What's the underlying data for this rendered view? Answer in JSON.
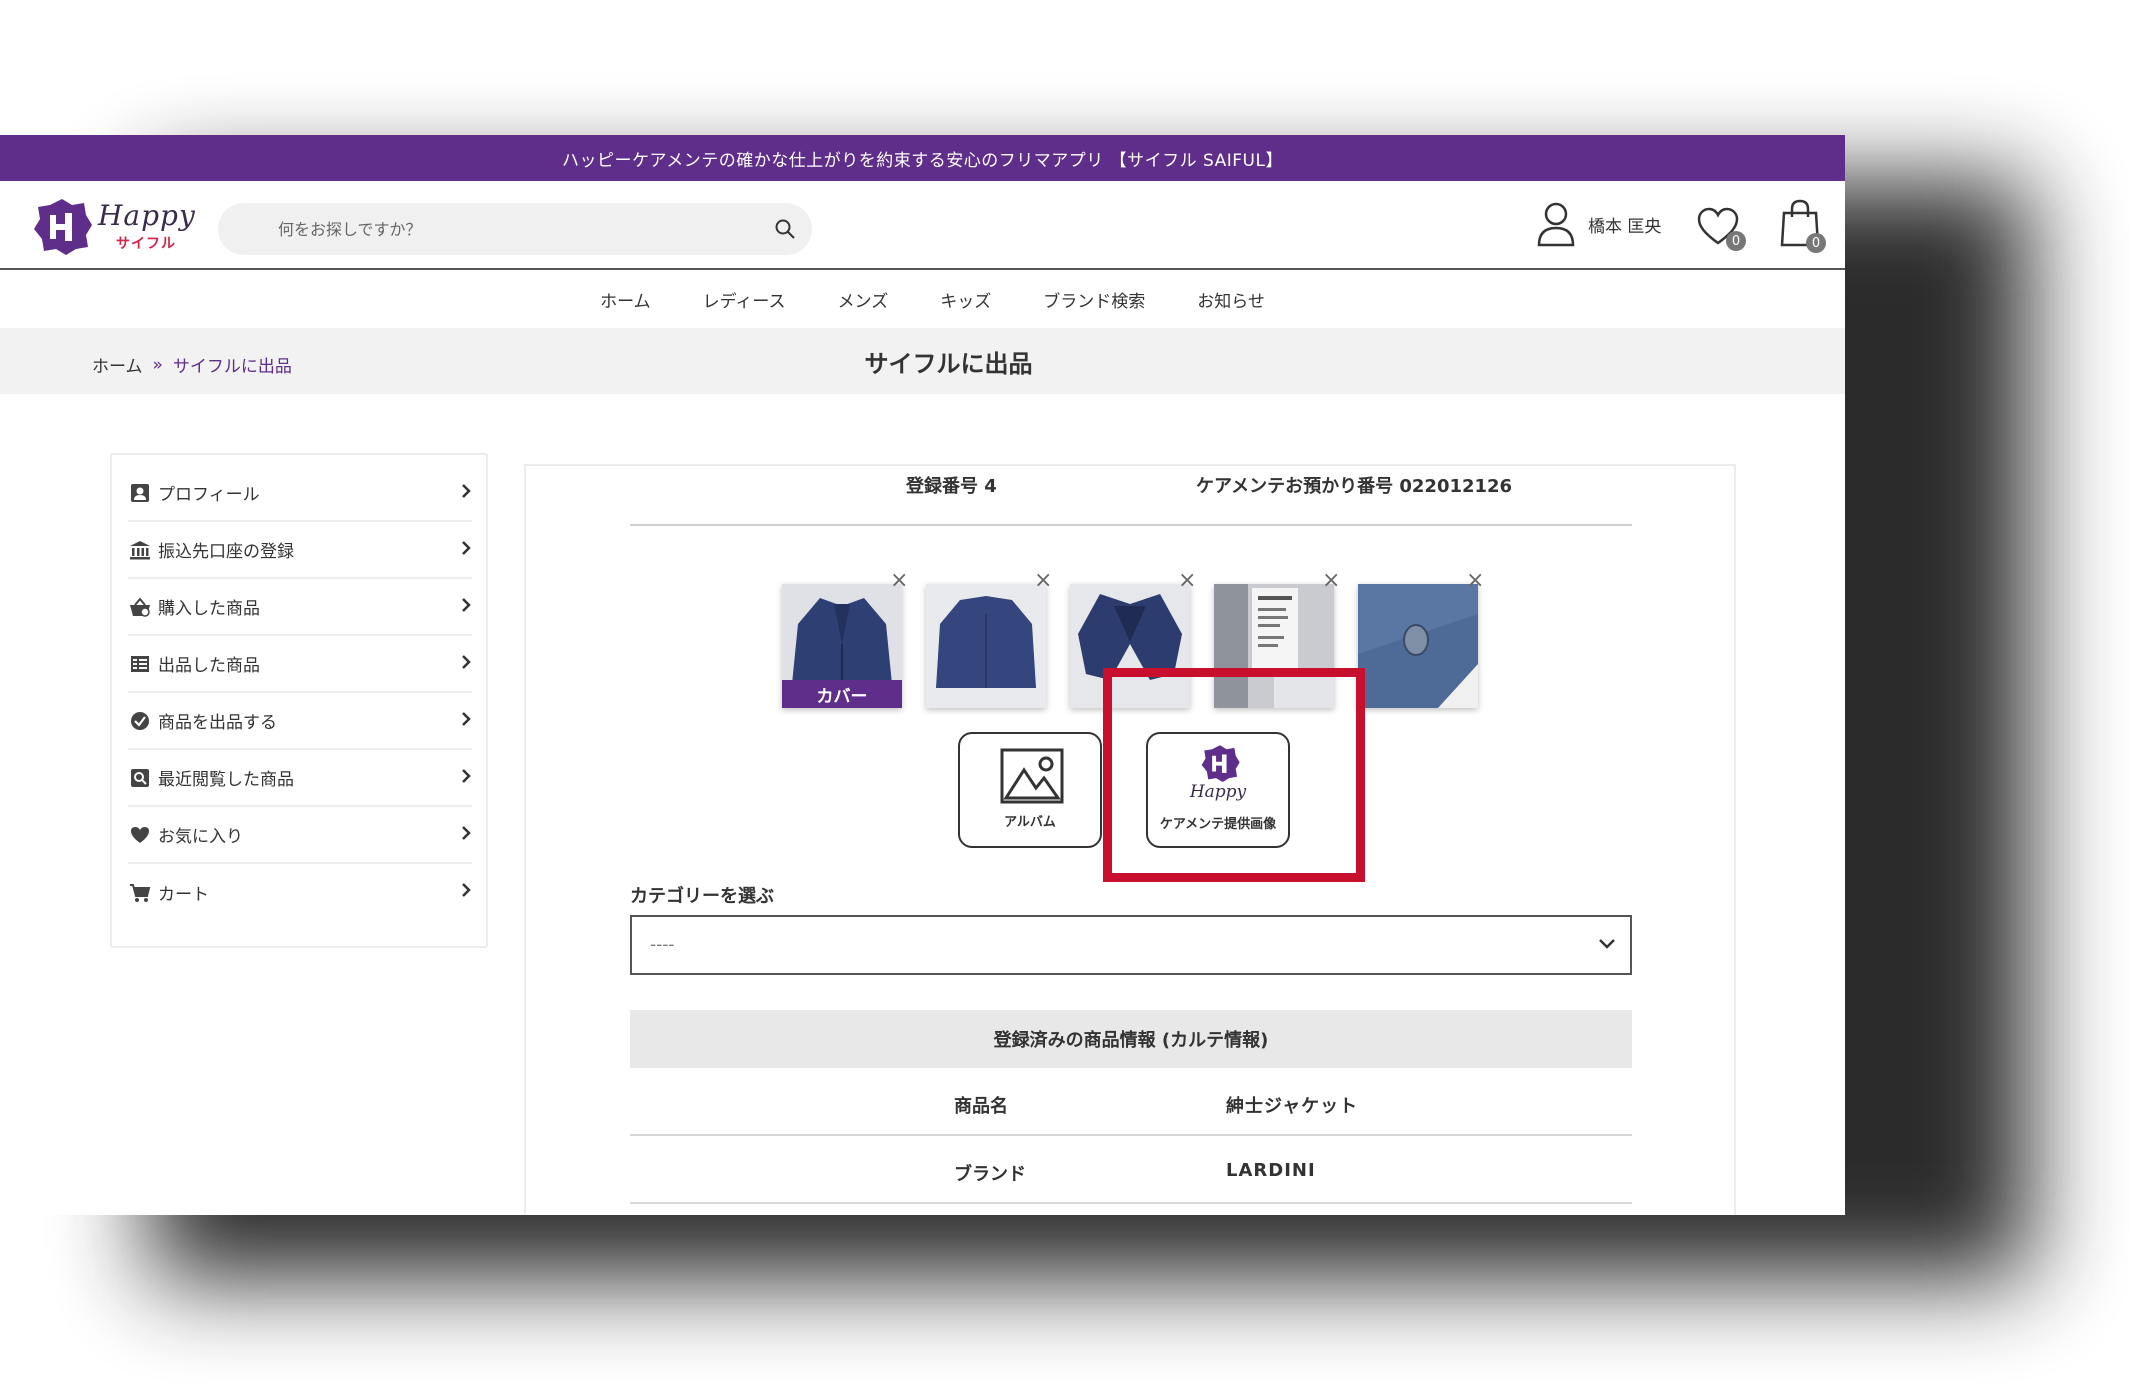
{
  "banner": {
    "text": "ハッピーケアメンテの確かな仕上がりを約束する安心のフリマアプリ 【サイフル SAIFUL】"
  },
  "logo": {
    "word": "Happy",
    "sub": "サイフル"
  },
  "search": {
    "placeholder": "何をお探しですか？"
  },
  "user": {
    "name": "橋本 匡央"
  },
  "favorites": {
    "count": "0"
  },
  "cart": {
    "count": "0"
  },
  "nav": [
    "ホーム",
    "レディース",
    "メンズ",
    "キッズ",
    "ブランド検索",
    "お知らせ"
  ],
  "breadcrumb": {
    "home": "ホーム",
    "sep": "»",
    "current": "サイフルに出品"
  },
  "page": {
    "title": "サイフルに出品"
  },
  "sidebar": {
    "items": [
      {
        "label": "プロフィール",
        "icon": "profile-icon"
      },
      {
        "label": "振込先口座の登録",
        "icon": "bank-icon"
      },
      {
        "label": "購入した商品",
        "icon": "basket-icon"
      },
      {
        "label": "出品した商品",
        "icon": "list-icon"
      },
      {
        "label": "商品を出品する",
        "icon": "check-circle-icon"
      },
      {
        "label": "最近閲覧した商品",
        "icon": "search-box-icon"
      },
      {
        "label": "お気に入り",
        "icon": "heart-icon"
      },
      {
        "label": "カート",
        "icon": "cart-icon"
      }
    ]
  },
  "registration": {
    "number": "登録番号 4",
    "care_number": "ケアメンテお預かり番号 022012126"
  },
  "photos": {
    "cover_label": "カバー",
    "close_symbol": "×"
  },
  "upload": {
    "album_label": "アルバム",
    "care_label": "ケアメンテ提供画像",
    "care_logo_word": "Happy"
  },
  "category": {
    "label": "カテゴリーを選ぶ",
    "value": "----"
  },
  "info": {
    "heading": "登録済みの商品情報 (カルテ情報)",
    "rows": [
      {
        "key": "商品名",
        "value": "紳士ジャケット"
      },
      {
        "key": "ブランド",
        "value": "LARDINI"
      }
    ]
  },
  "colors": {
    "brand": "#5f2d8a",
    "highlight": "#c8102e"
  }
}
